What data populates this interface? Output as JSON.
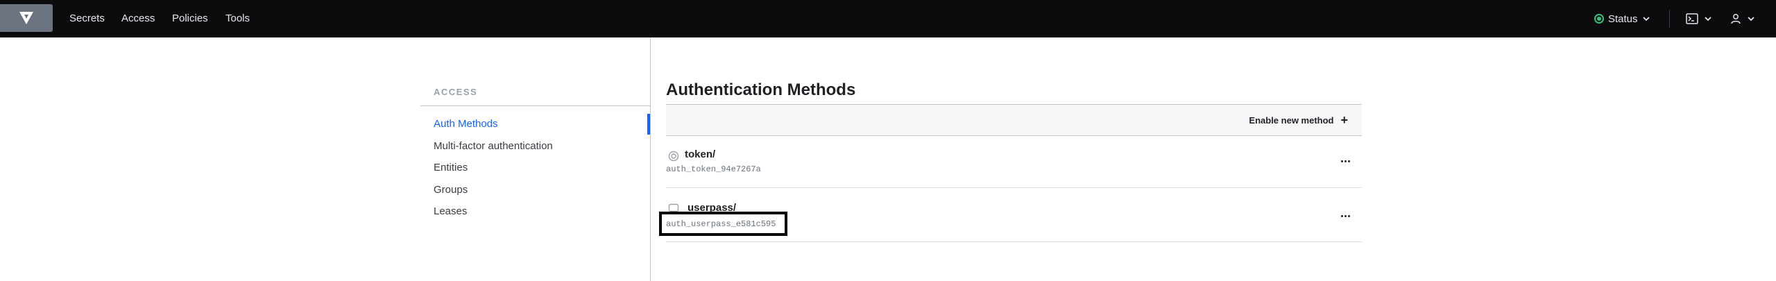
{
  "nav": {
    "links": [
      "Secrets",
      "Access",
      "Policies",
      "Tools"
    ],
    "status_label": "Status",
    "icons": {
      "logo": "vault-logo-icon",
      "status": "status-indicator-icon",
      "console": "terminal-icon",
      "user": "user-icon",
      "chevron": "chevron-down-icon"
    }
  },
  "sidebar": {
    "header": "ACCESS",
    "items": [
      {
        "label": "Auth Methods",
        "active": true
      },
      {
        "label": "Multi-factor authentication"
      },
      {
        "label": "Entities"
      },
      {
        "label": "Groups"
      },
      {
        "label": "Leases"
      }
    ]
  },
  "main": {
    "title": "Authentication Methods",
    "enable_label": "Enable new method",
    "methods": [
      {
        "name": "token/",
        "accessor": "auth_token_94e7267a",
        "icon": "token-icon"
      },
      {
        "name": "userpass/",
        "accessor": "auth_userpass_e581c595",
        "icon": "userpass-icon"
      }
    ]
  },
  "colors": {
    "topbar": "#0c0c0e",
    "accent": "#1563ff",
    "status_ok": "#36c17a"
  }
}
